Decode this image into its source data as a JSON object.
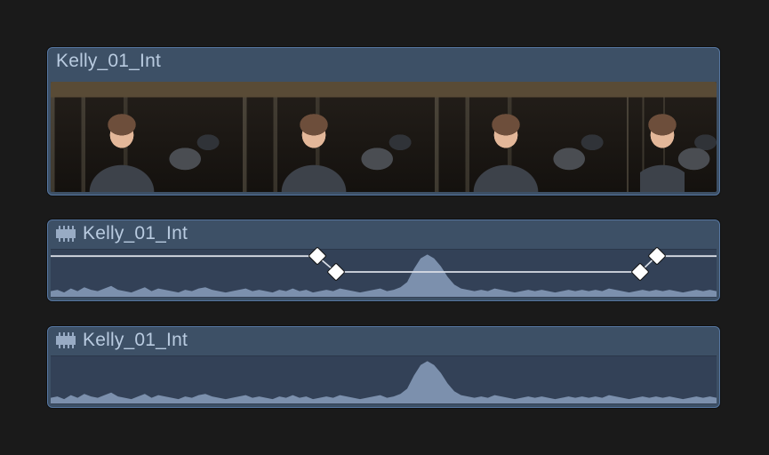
{
  "clips": [
    {
      "kind": "video",
      "title": "Kelly_01_Int",
      "thumbnails": 4
    },
    {
      "kind": "audio",
      "title": "Kelly_01_Int",
      "volume_envelope": {
        "keyframes": [
          {
            "x_pct": 40.0,
            "level": 1.0
          },
          {
            "x_pct": 42.8,
            "level": 0.55
          },
          {
            "x_pct": 88.5,
            "level": 0.55
          },
          {
            "x_pct": 91.0,
            "level": 1.0
          }
        ]
      }
    },
    {
      "kind": "audio",
      "title": "Kelly_01_Int"
    }
  ],
  "waveform_profile": [
    5,
    6,
    4,
    7,
    5,
    8,
    6,
    5,
    7,
    9,
    6,
    5,
    4,
    6,
    8,
    5,
    7,
    6,
    5,
    4,
    6,
    5,
    7,
    8,
    6,
    5,
    4,
    5,
    6,
    7,
    5,
    6,
    5,
    4,
    6,
    5,
    7,
    5,
    6,
    4,
    5,
    6,
    5,
    7,
    6,
    5,
    4,
    5,
    6,
    7,
    5,
    6,
    8,
    12,
    22,
    30,
    33,
    30,
    24,
    16,
    10,
    7,
    6,
    5,
    6,
    5,
    7,
    6,
    5,
    4,
    5,
    6,
    5,
    6,
    5,
    4,
    5,
    6,
    5,
    6,
    5,
    6,
    5,
    7,
    6,
    5,
    4,
    5,
    6,
    5,
    6,
    5,
    6,
    5,
    4,
    5,
    6,
    5,
    6,
    5
  ]
}
